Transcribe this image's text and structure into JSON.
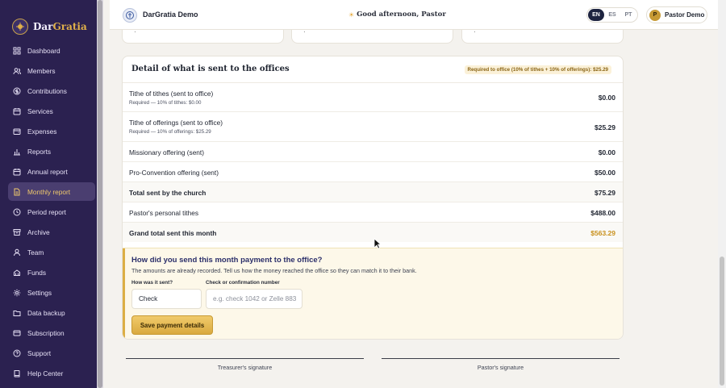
{
  "app": {
    "brand_first": "Dar",
    "brand_second": "Gratia",
    "title": "DarGratia Demo",
    "greeting": "Good afternoon, Pastor"
  },
  "sidebar": {
    "items": [
      {
        "label": "Dashboard",
        "icon": "grid-icon",
        "active": false
      },
      {
        "label": "Members",
        "icon": "users-icon",
        "active": false
      },
      {
        "label": "Contributions",
        "icon": "coin-icon",
        "active": false
      },
      {
        "label": "Services",
        "icon": "calendar-icon",
        "active": false
      },
      {
        "label": "Expenses",
        "icon": "wallet-icon",
        "active": false
      },
      {
        "label": "Reports",
        "icon": "bar-chart-icon",
        "active": false
      },
      {
        "label": "Annual report",
        "icon": "calendar-icon",
        "active": false
      },
      {
        "label": "Monthly report",
        "icon": "document-icon",
        "active": true
      },
      {
        "label": "Period report",
        "icon": "clock-icon",
        "active": false
      },
      {
        "label": "Archive",
        "icon": "archive-icon",
        "active": false
      },
      {
        "label": "Team",
        "icon": "team-icon",
        "active": false
      },
      {
        "label": "Funds",
        "icon": "funds-icon",
        "active": false
      },
      {
        "label": "Settings",
        "icon": "gear-icon",
        "active": false
      },
      {
        "label": "Data backup",
        "icon": "folder-icon",
        "active": false
      },
      {
        "label": "Subscription",
        "icon": "card-icon",
        "active": false
      },
      {
        "label": "Support",
        "icon": "help-circle-icon",
        "active": false
      },
      {
        "label": "Help Center",
        "icon": "book-icon",
        "active": false
      }
    ]
  },
  "topbar": {
    "languages": [
      "EN",
      "ES",
      "PT"
    ],
    "active_language": "EN",
    "user_initial": "P",
    "user_name": "Pastor Demo"
  },
  "detail": {
    "title": "Detail of what is sent to the offices",
    "required_badge": "Required to office (10% of tithes + 10% of offerings): $25.29",
    "rows": [
      {
        "label": "Tithe of tithes (sent to office)",
        "sub": "Required — 10% of tithes: $0.00",
        "amount": "$0.00"
      },
      {
        "label": "Tithe of offerings (sent to office)",
        "sub": "Required — 10% of offerings: $25.29",
        "amount": "$25.29"
      },
      {
        "label": "Missionary offering (sent)",
        "amount": "$0.00"
      },
      {
        "label": "Pro-Convention offering (sent)",
        "amount": "$50.00"
      },
      {
        "label": "Total sent by the church",
        "amount": "$75.29"
      },
      {
        "label": "Pastor's personal tithes",
        "amount": "$488.00"
      },
      {
        "label": "Grand total sent this month",
        "amount": "$563.29"
      }
    ]
  },
  "payment": {
    "title": "How did you send this month payment to the office?",
    "description": "The amounts are already recorded. Tell us how the money reached the office so they can match it to their bank.",
    "method_label": "How was it sent?",
    "method_value": "Check",
    "confirmation_label": "Check or confirmation number",
    "confirmation_placeholder": "e.g. check 1042 or Zelle 883",
    "save_label": "Save payment details"
  },
  "signatures": {
    "treasurer": "Treasurer's signature",
    "pastor": "Pastor's signature"
  },
  "colors": {
    "sidebar_bg": "#2b2150",
    "accent_gold": "#d9a93f",
    "title_navy": "#2b2f6a"
  }
}
